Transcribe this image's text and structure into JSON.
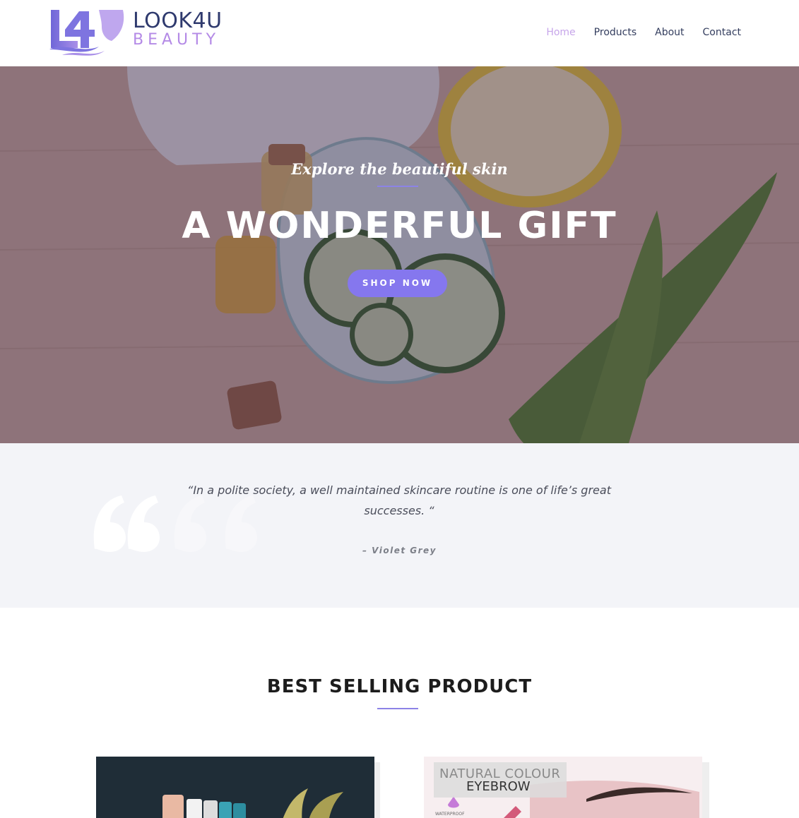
{
  "brand": {
    "name_top": "LOOK4U",
    "name_bottom": "BEAUTY",
    "mark": "L4",
    "colors": {
      "navy": "#2f3a6e",
      "lavender": "#b48ae6",
      "accent": "#8577ee"
    }
  },
  "nav": {
    "items": [
      {
        "label": "Home",
        "active": true
      },
      {
        "label": "Products",
        "active": false
      },
      {
        "label": "About",
        "active": false
      },
      {
        "label": "Contact",
        "active": false
      }
    ]
  },
  "hero": {
    "subtitle": "Explore the beautiful skin",
    "title": "A WONDERFUL GIFT",
    "button": "SHOP NOW"
  },
  "quote": {
    "text": "“In a polite society, a well maintained skincare routine is one of life’s great successes. “",
    "author": "– Violet Grey",
    "icon": "quote-icon"
  },
  "best_selling": {
    "title": "BEST SELLING PRODUCT",
    "cards": [
      {
        "image": "skincare-bottles-image"
      },
      {
        "image": "eyebrow-product-image",
        "label_line1": "NATURAL COLOUR",
        "label_line2": "EYEBROW",
        "label_line3": "WATERPROOF"
      }
    ]
  }
}
